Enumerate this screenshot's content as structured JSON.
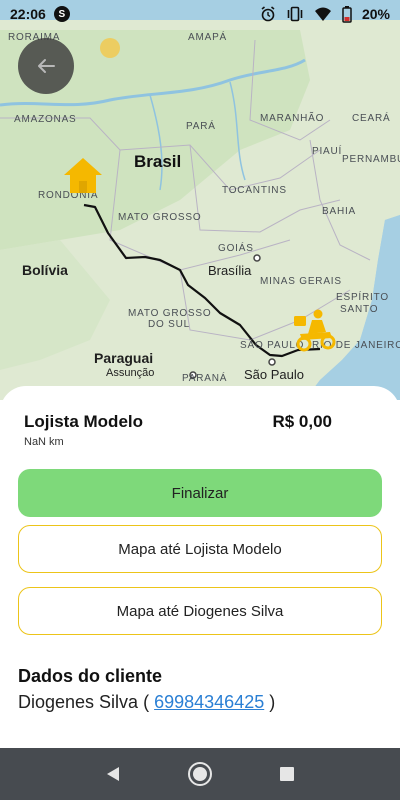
{
  "status_bar": {
    "time": "22:06",
    "left_icon": "S",
    "battery": "20%",
    "icons": [
      "alarm-icon",
      "vibrate-icon",
      "wifi-icon",
      "battery-icon"
    ]
  },
  "map": {
    "labels": {
      "roraima": "RORAIMA",
      "amapa": "AMAPÁ",
      "amazonas": "AMAZONAS",
      "para": "PARÁ",
      "maranhao": "MARANHÃO",
      "ceara": "CEARÁ",
      "brasil": "Brasil",
      "piaui": "PIAUÍ",
      "pernambuco": "PERNAMBUCO",
      "rondonia": "RONDÔNIA",
      "tocantins": "TOCANTINS",
      "mato_grosso": "MATO GROSSO",
      "bahia": "BAHIA",
      "goias": "GOIÁS",
      "bolivia": "Bolívia",
      "brasilia": "Brasília",
      "minas_gerais": "MINAS GERAIS",
      "espirito_santo_1": "ESPÍRITO",
      "espirito_santo_2": "SANTO",
      "mato_grosso_do_sul_1": "MATO GROSSO",
      "mato_grosso_do_sul_2": "DO SUL",
      "sao_paulo_state": "SÃO PAULO",
      "rio_de_janeiro": "RIO DE JANEIRO",
      "paraguai": "Paraguai",
      "assuncao": "Assunção",
      "parana": "PARANÁ",
      "sao_paulo_city": "São Paulo"
    }
  },
  "order": {
    "store_name": "Lojista Modelo",
    "distance": "NaN km",
    "price": "R$ 0,00"
  },
  "actions": {
    "finalize": "Finalizar",
    "map_to_store": "Mapa até Lojista Modelo",
    "map_to_client": "Mapa até Diogenes Silva"
  },
  "client": {
    "title": "Dados do cliente",
    "name": "Diogenes Silva",
    "open_paren": "(",
    "phone": "69984346425",
    "close_paren": ")"
  },
  "colors": {
    "finalize_bg": "#7ed97a",
    "outline_border": "#ecc419",
    "phone_link": "#2a7fd4",
    "marker_yellow": "#f5b800",
    "nav_bar": "#474b50"
  }
}
